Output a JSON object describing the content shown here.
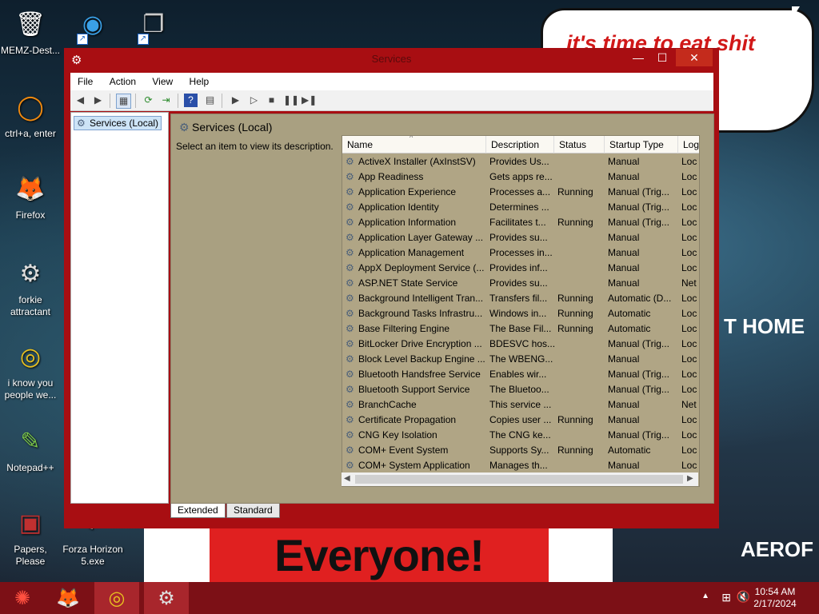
{
  "desktop": {
    "icons": [
      {
        "label": "MEMZ-Dest...",
        "glyph": "🗑"
      },
      {
        "label": "",
        "glyph": "◉"
      },
      {
        "label": "",
        "glyph": "❐"
      },
      {
        "label": "ctrl+a, enter",
        "glyph": "◯"
      },
      {
        "label": "Firefox",
        "glyph": "🦊"
      },
      {
        "label": "forkie attractant",
        "glyph": "⚙"
      },
      {
        "label": "i know you people we...",
        "glyph": "◎"
      },
      {
        "label": "Notepad++",
        "glyph": "✎"
      },
      {
        "label": "Papers, Please",
        "glyph": "▣"
      },
      {
        "label": "Forza Horizon 5.exe",
        "glyph": "◐"
      }
    ],
    "wallpaper": {
      "bubble_text": "it's time to eat shit celebrate",
      "banner_text": "Everyone!",
      "sign_home": "T HOME",
      "sign_aero": "AEROF"
    }
  },
  "window": {
    "title": "Services",
    "controls": {
      "minimize": "—",
      "maximize": "☐",
      "close": "✕"
    },
    "menu": [
      "File",
      "Action",
      "View",
      "Help"
    ],
    "tree_node": "Services (Local)",
    "content_header": "Services (Local)",
    "description_prompt": "Select an item to view its description.",
    "columns": [
      "Name",
      "Description",
      "Status",
      "Startup Type",
      "Log"
    ],
    "rows": [
      [
        "ActiveX Installer (AxInstSV)",
        "Provides Us...",
        "",
        "Manual",
        "Loc"
      ],
      [
        "App Readiness",
        "Gets apps re...",
        "",
        "Manual",
        "Loc"
      ],
      [
        "Application Experience",
        "Processes a...",
        "Running",
        "Manual (Trig...",
        "Loc"
      ],
      [
        "Application Identity",
        "Determines ...",
        "",
        "Manual (Trig...",
        "Loc"
      ],
      [
        "Application Information",
        "Facilitates t...",
        "Running",
        "Manual (Trig...",
        "Loc"
      ],
      [
        "Application Layer Gateway ...",
        "Provides su...",
        "",
        "Manual",
        "Loc"
      ],
      [
        "Application Management",
        "Processes in...",
        "",
        "Manual",
        "Loc"
      ],
      [
        "AppX Deployment Service (...",
        "Provides inf...",
        "",
        "Manual",
        "Loc"
      ],
      [
        "ASP.NET State Service",
        "Provides su...",
        "",
        "Manual",
        "Net"
      ],
      [
        "Background Intelligent Tran...",
        "Transfers fil...",
        "Running",
        "Automatic (D...",
        "Loc"
      ],
      [
        "Background Tasks Infrastru...",
        "Windows in...",
        "Running",
        "Automatic",
        "Loc"
      ],
      [
        "Base Filtering Engine",
        "The Base Fil...",
        "Running",
        "Automatic",
        "Loc"
      ],
      [
        "BitLocker Drive Encryption ...",
        "BDESVC hos...",
        "",
        "Manual (Trig...",
        "Loc"
      ],
      [
        "Block Level Backup Engine ...",
        "The WBENG...",
        "",
        "Manual",
        "Loc"
      ],
      [
        "Bluetooth Handsfree Service",
        "Enables wir...",
        "",
        "Manual (Trig...",
        "Loc"
      ],
      [
        "Bluetooth Support Service",
        "The Bluetoo...",
        "",
        "Manual (Trig...",
        "Loc"
      ],
      [
        "BranchCache",
        "This service ...",
        "",
        "Manual",
        "Net"
      ],
      [
        "Certificate Propagation",
        "Copies user ...",
        "Running",
        "Manual",
        "Loc"
      ],
      [
        "CNG Key Isolation",
        "The CNG ke...",
        "",
        "Manual (Trig...",
        "Loc"
      ],
      [
        "COM+ Event System",
        "Supports Sy...",
        "Running",
        "Automatic",
        "Loc"
      ],
      [
        "COM+ System Application",
        "Manages th...",
        "",
        "Manual",
        "Loc"
      ]
    ],
    "tabs": [
      "Extended",
      "Standard"
    ],
    "colors": {
      "frame": "#a80e12",
      "content_bg": "#a9a081",
      "selection": "#cde4f7"
    }
  },
  "taskbar": {
    "time": "10:54 AM",
    "date": "2/17/2024",
    "tray_icons": [
      "chevron-up-icon",
      "network-icon",
      "volume-muted-icon"
    ]
  }
}
